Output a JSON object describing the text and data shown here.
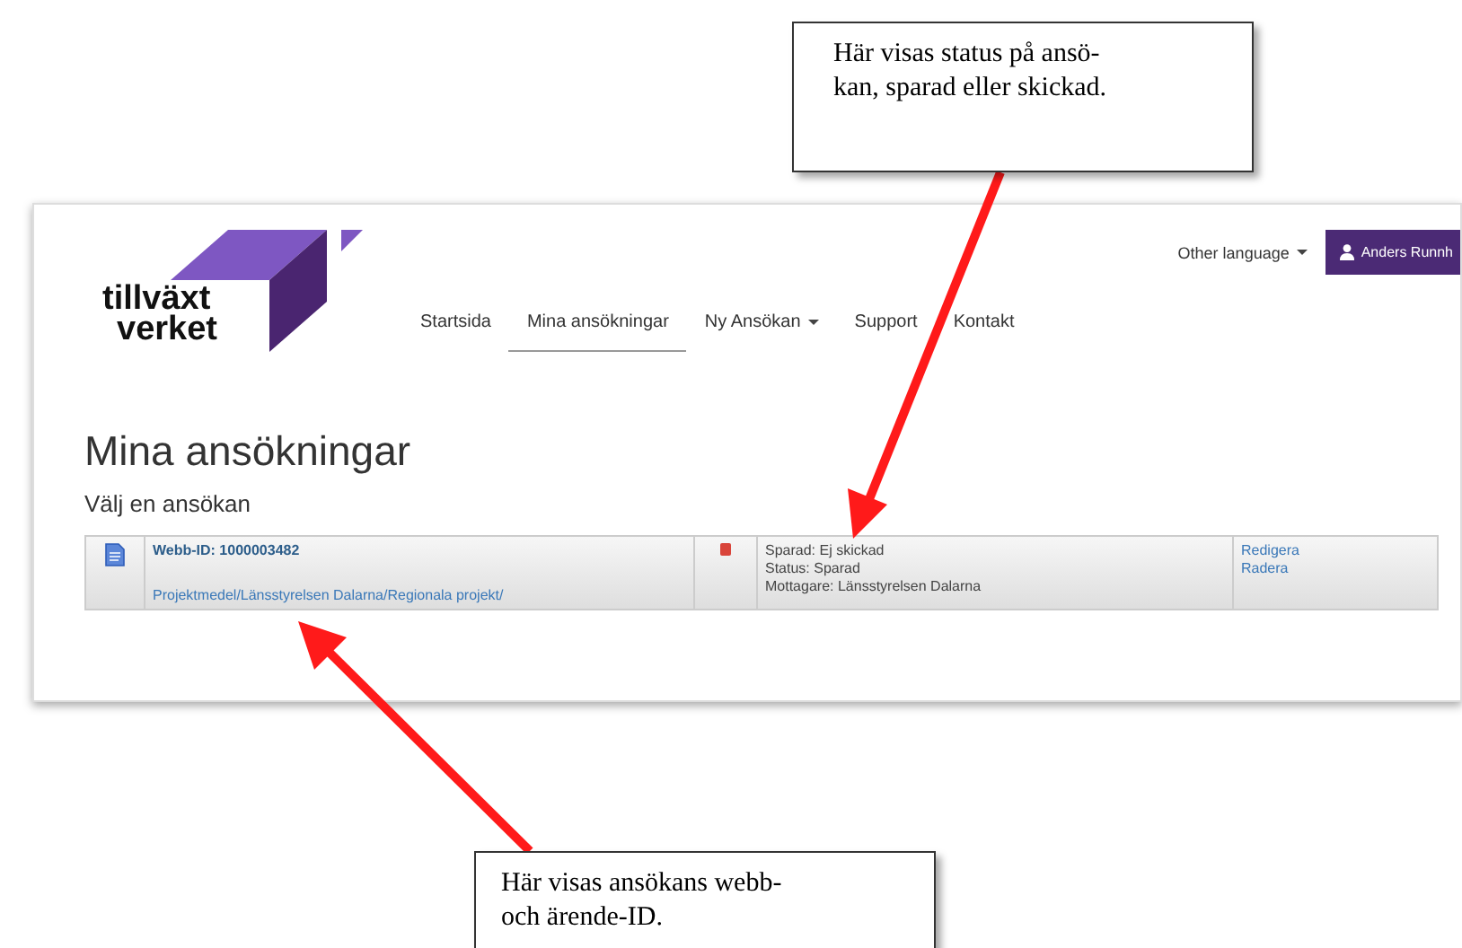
{
  "callouts": [
    {
      "text": "Här visas status på ansö-\nkan, sparad eller skickad."
    },
    {
      "text": "Här visas ansökans webb-\noch ärende-ID."
    }
  ],
  "header": {
    "logo": [
      "tillväxt",
      "verket"
    ],
    "language": "Other language",
    "user": "Anders Runnh"
  },
  "nav": [
    {
      "label": "Startsida",
      "selected": false,
      "dropdown": false
    },
    {
      "label": "Mina ansökningar",
      "selected": true,
      "dropdown": false
    },
    {
      "label": "Ny Ansökan",
      "selected": false,
      "dropdown": true
    },
    {
      "label": "Support",
      "selected": false,
      "dropdown": false
    },
    {
      "label": "Kontakt",
      "selected": false,
      "dropdown": false
    }
  ],
  "page": {
    "title": "Mina ansökningar",
    "subtitle": "Välj en ansökan"
  },
  "applications": [
    {
      "webb_id": "Webb-ID: 1000003482",
      "path": "Projektmedel/Länsstyrelsen Dalarna/Regionala projekt/",
      "status_lines": [
        "Sparad: Ej skickad",
        "Status: Sparad",
        "Mottagare: Länsstyrelsen Dalarna"
      ],
      "actions": [
        "Redigera",
        "Radera"
      ]
    }
  ]
}
